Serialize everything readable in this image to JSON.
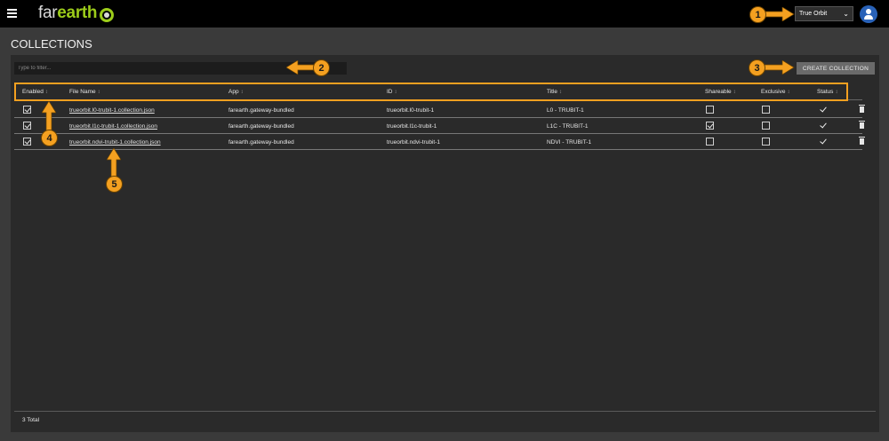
{
  "header": {
    "logo_far": "far",
    "logo_earth": "earth",
    "org_selected": "True Orbit",
    "org_icon": "chevron-down-icon"
  },
  "page": {
    "title": "COLLECTIONS",
    "filter_placeholder": "Type to filter...",
    "create_button": "CREATE COLLECTION"
  },
  "table": {
    "sort_glyph": "↕",
    "columns": [
      "Enabled",
      "File Name",
      "App",
      "ID",
      "Title",
      "Shareable",
      "Exclusive",
      "Status"
    ],
    "rows": [
      {
        "enabled": true,
        "file": "trueorbit.l0-trubit-1.collection.json",
        "app": "farearth.gateway-bundled",
        "id": "trueorbit.l0-trubit-1",
        "title": "L0 - TRUBIT-1",
        "shareable": false,
        "exclusive": false,
        "status": "ok"
      },
      {
        "enabled": true,
        "file": "trueorbit.l1c-trubit-1.collection.json",
        "app": "farearth.gateway-bundled",
        "id": "trueorbit.l1c-trubit-1",
        "title": "L1C - TRUBIT-1",
        "shareable": true,
        "exclusive": false,
        "status": "ok"
      },
      {
        "enabled": true,
        "file": "trueorbit.ndvi-trubit-1.collection.json",
        "app": "farearth.gateway-bundled",
        "id": "trueorbit.ndvi-trubit-1",
        "title": "NDVI - TRUBIT-1",
        "shareable": false,
        "exclusive": false,
        "status": "ok"
      }
    ],
    "total": "3 Total"
  },
  "annotations": {
    "color": "#f4a020",
    "badges": [
      "1",
      "2",
      "3",
      "4",
      "5"
    ]
  }
}
